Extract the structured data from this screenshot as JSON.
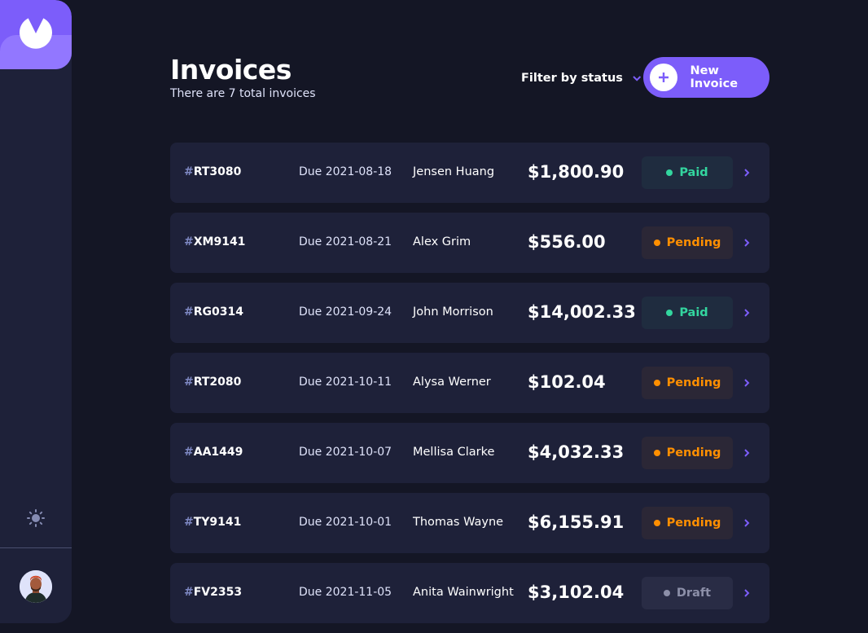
{
  "app": {
    "title": "Invoices",
    "subtitle": "There are 7 total invoices"
  },
  "filter": {
    "label": "Filter by status"
  },
  "new_button": {
    "label": "New Invoice"
  },
  "sidebar": {
    "logo": "logo-icon",
    "theme_toggle": "sun-icon",
    "avatar": "user-avatar"
  },
  "colors": {
    "accent": "#7c5dfa",
    "paid": "#33d69f",
    "pending": "#ff8f00",
    "draft": "#8c8fa8"
  },
  "invoices": [
    {
      "hash": "#",
      "id": "RT3080",
      "due": "Due 2021-08-18",
      "client": "Jensen Huang",
      "amount": "$1,800.90",
      "status": "Paid",
      "status_key": "paid"
    },
    {
      "hash": "#",
      "id": "XM9141",
      "due": "Due 2021-08-21",
      "client": "Alex Grim",
      "amount": "$556.00",
      "status": "Pending",
      "status_key": "pending"
    },
    {
      "hash": "#",
      "id": "RG0314",
      "due": "Due 2021-09-24",
      "client": "John Morrison",
      "amount": "$14,002.33",
      "status": "Paid",
      "status_key": "paid"
    },
    {
      "hash": "#",
      "id": "RT2080",
      "due": "Due 2021-10-11",
      "client": "Alysa Werner",
      "amount": "$102.04",
      "status": "Pending",
      "status_key": "pending"
    },
    {
      "hash": "#",
      "id": "AA1449",
      "due": "Due 2021-10-07",
      "client": "Mellisa Clarke",
      "amount": "$4,032.33",
      "status": "Pending",
      "status_key": "pending"
    },
    {
      "hash": "#",
      "id": "TY9141",
      "due": "Due 2021-10-01",
      "client": "Thomas Wayne",
      "amount": "$6,155.91",
      "status": "Pending",
      "status_key": "pending"
    },
    {
      "hash": "#",
      "id": "FV2353",
      "due": "Due 2021-11-05",
      "client": "Anita Wainwright",
      "amount": "$3,102.04",
      "status": "Draft",
      "status_key": "draft"
    }
  ]
}
